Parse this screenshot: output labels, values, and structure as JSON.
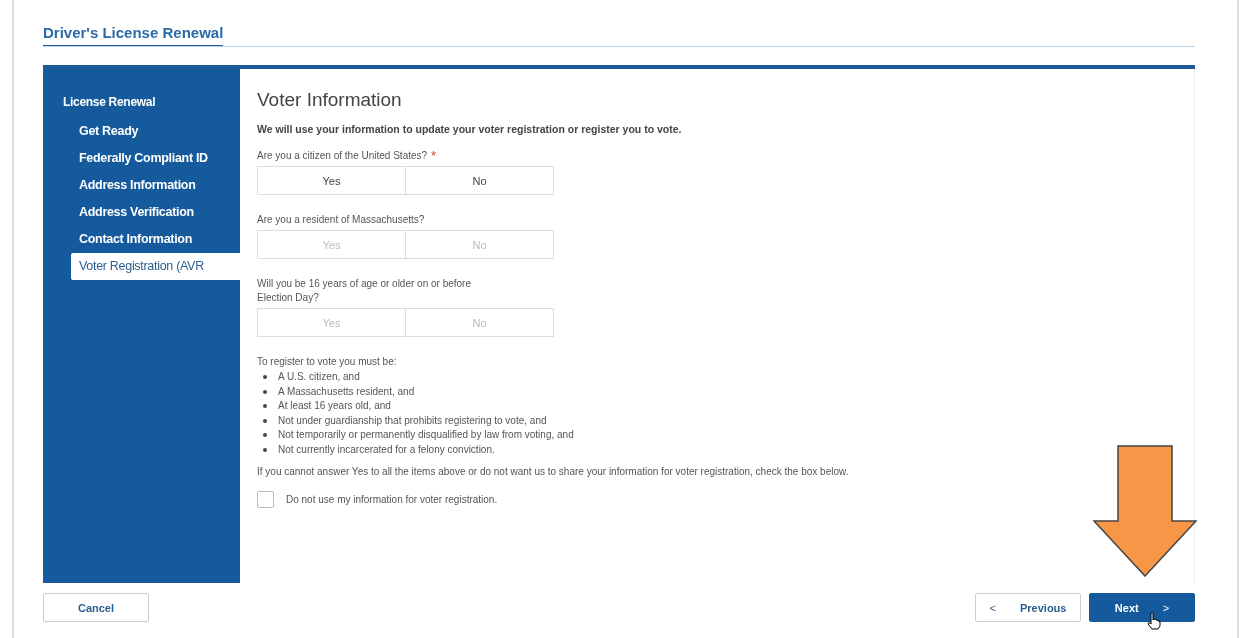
{
  "page_title": "Driver's License Renewal",
  "sidebar": {
    "heading": "License Renewal",
    "items": [
      {
        "label": "Get Ready",
        "selected": false
      },
      {
        "label": "Federally Compliant ID",
        "selected": false
      },
      {
        "label": "Address Information",
        "selected": false
      },
      {
        "label": "Address Verification",
        "selected": false
      },
      {
        "label": "Contact Information",
        "selected": false
      },
      {
        "label": "Voter Registration (AVR",
        "selected": true
      }
    ]
  },
  "form": {
    "title": "Voter Information",
    "intro": "We will use your information to update your voter registration or register you to vote.",
    "questions": [
      {
        "label": "Are you a citizen of the United States?",
        "required_mark": "*",
        "disabled": false,
        "options": [
          {
            "label": "Yes",
            "selected": false
          },
          {
            "label": "No",
            "selected": false
          }
        ]
      },
      {
        "label": "Are you a resident of Massachusetts?",
        "disabled": true,
        "options": [
          {
            "label": "Yes",
            "selected": false
          },
          {
            "label": "No",
            "selected": false
          }
        ]
      },
      {
        "label": "Will you be 16 years of age or older on or before Election Day?",
        "disabled": true,
        "options": [
          {
            "label": "Yes",
            "selected": false
          },
          {
            "label": "No",
            "selected": false
          }
        ]
      }
    ],
    "requirements_intro": "To register to vote you must be:",
    "requirements": [
      "A U.S. citizen, and",
      "A Massachusetts resident, and",
      "At least 16 years old, and",
      "Not under guardianship that prohibits registering to vote, and",
      "Not temporarily or permanently disqualified by law from voting, and",
      "Not currently incarcerated for a felony conviction."
    ],
    "opt_out_note": "If you cannot answer Yes to all the items above or do not want us to share your information for voter registration, check the box below.",
    "opt_out": {
      "label": "Do not use my information for voter registration.",
      "checked": false
    }
  },
  "footer": {
    "cancel": "Cancel",
    "previous_icon": "<",
    "previous": "Previous",
    "next": "Next",
    "next_icon": ">"
  }
}
